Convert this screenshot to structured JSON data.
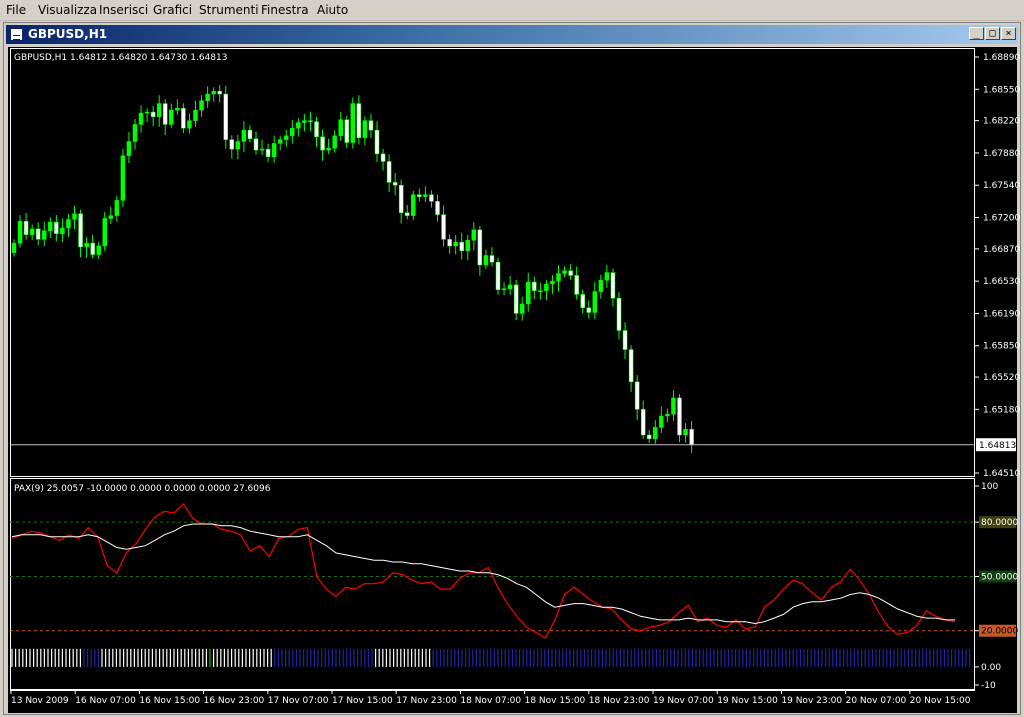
{
  "menu": [
    "File",
    "Visualizza",
    "Inserisci",
    "Grafici",
    "Strumenti",
    "Finestra",
    "Aiuto"
  ],
  "window": {
    "title": "GBPUSD,H1"
  },
  "colors": {
    "bull": "#ffffff",
    "bear": "#00ff00",
    "wick": "#00ff00",
    "pax": "#ff0000",
    "signal": "#ffffff",
    "grid_green": "#1e6e1e",
    "grid_orange": "#c85a28",
    "hist_white": "#ffffff",
    "hist_blue": "#2323a0"
  },
  "chart_data": [
    {
      "type": "candlestick",
      "header": "GBPUSD,H1  1.64812 1.64820 1.64730 1.64813",
      "ylim": [
        1.6451,
        1.6889
      ],
      "y_ticks": [
        "1.68890",
        "1.68550",
        "1.68220",
        "1.67880",
        "1.67540",
        "1.67200",
        "1.66870",
        "1.66530",
        "1.66190",
        "1.65850",
        "1.65520",
        "1.65180",
        "1.64510"
      ],
      "price_label": "1.64813",
      "last_price": 1.64813,
      "closes": [
        1.6693,
        1.6716,
        1.6702,
        1.6708,
        1.6697,
        1.6706,
        1.6715,
        1.6703,
        1.6709,
        1.6718,
        1.6724,
        1.6689,
        1.6693,
        1.6681,
        1.669,
        1.6719,
        1.6722,
        1.6738,
        1.6785,
        1.68,
        1.6818,
        1.683,
        1.6831,
        1.6826,
        1.684,
        1.6818,
        1.6833,
        1.6835,
        1.6814,
        1.6822,
        1.6833,
        1.6843,
        1.685,
        1.6853,
        1.685,
        1.6802,
        1.6792,
        1.68,
        1.6812,
        1.6803,
        1.6791,
        1.6792,
        1.6784,
        1.6798,
        1.6802,
        1.6806,
        1.6814,
        1.682,
        1.6822,
        1.6821,
        1.6805,
        1.6791,
        1.6793,
        1.6806,
        1.6823,
        1.6799,
        1.684,
        1.6804,
        1.6822,
        1.6812,
        1.6787,
        1.6779,
        1.6757,
        1.6754,
        1.6725,
        1.6722,
        1.6744,
        1.6742,
        1.6744,
        1.6737,
        1.6723,
        1.6697,
        1.669,
        1.6694,
        1.6685,
        1.6696,
        1.6707,
        1.667,
        1.668,
        1.6673,
        1.6644,
        1.6645,
        1.6649,
        1.6619,
        1.6629,
        1.6652,
        1.6643,
        1.6643,
        1.665,
        1.6653,
        1.6661,
        1.6664,
        1.6659,
        1.6639,
        1.6625,
        1.662,
        1.6642,
        1.6654,
        1.6662,
        1.6635,
        1.6601,
        1.6581,
        1.6547,
        1.6518,
        1.6491,
        1.6487,
        1.6499,
        1.6511,
        1.6513,
        1.653,
        1.6491,
        1.6497,
        1.6481
      ]
    },
    {
      "type": "line",
      "header": "PAX(9) 25.0057 -10.0000 0.0000 0.0000 0.0000 27.6096",
      "ylim": [
        -10,
        100
      ],
      "y_ticks": [
        "100",
        "80.0000",
        "50.0000",
        "20.0000",
        "0.00",
        "-10"
      ],
      "levels": [
        80,
        50,
        20
      ],
      "series": [
        {
          "values": [
            71,
            73,
            75,
            74,
            72,
            70,
            73,
            71,
            77,
            72,
            56,
            52,
            63,
            68,
            76,
            83,
            86,
            85,
            90,
            82,
            79,
            79,
            76,
            75,
            73,
            64,
            67,
            61,
            71,
            72,
            76,
            77,
            50,
            43,
            39,
            44,
            43,
            46,
            46,
            47,
            52,
            51,
            48,
            46,
            47,
            43,
            43,
            49,
            52,
            52,
            55,
            44,
            35,
            28,
            22,
            19,
            16,
            26,
            40,
            44,
            40,
            36,
            33,
            32,
            26,
            21,
            20,
            22,
            23,
            25,
            30,
            34,
            25,
            27,
            23,
            22,
            26,
            21,
            22,
            33,
            37,
            43,
            48,
            46,
            41,
            37,
            44,
            47,
            54,
            48,
            40,
            30,
            22,
            18,
            19,
            23,
            31,
            28,
            26,
            25
          ]
        },
        {
          "values": [
            72,
            73,
            73,
            73,
            72,
            72,
            72,
            72,
            73,
            72,
            69,
            66,
            65,
            66,
            67,
            70,
            73,
            75,
            78,
            79,
            79,
            79,
            78,
            78,
            77,
            75,
            74,
            73,
            72,
            72,
            72,
            73,
            70,
            67,
            63,
            62,
            61,
            60,
            59,
            59,
            58,
            58,
            57,
            57,
            56,
            55,
            54,
            53,
            53,
            52,
            52,
            51,
            49,
            46,
            44,
            40,
            36,
            33,
            34,
            35,
            35,
            34,
            33,
            33,
            32,
            30,
            28,
            27,
            26,
            26,
            26,
            27,
            26,
            26,
            26,
            25,
            25,
            25,
            24,
            25,
            27,
            29,
            33,
            35,
            36,
            36,
            37,
            38,
            40,
            41,
            40,
            38,
            35,
            32,
            30,
            28,
            27,
            27,
            26,
            26
          ]
        }
      ],
      "histogram": {
        "low": 0.0,
        "high": 10.0
      }
    }
  ],
  "x_labels": [
    "13 Nov 2009",
    "16 Nov 07:00",
    "16 Nov 15:00",
    "16 Nov 23:00",
    "17 Nov 07:00",
    "17 Nov 15:00",
    "17 Nov 23:00",
    "18 Nov 07:00",
    "18 Nov 15:00",
    "18 Nov 23:00",
    "19 Nov 07:00",
    "19 Nov 15:00",
    "19 Nov 23:00",
    "20 Nov 07:00",
    "20 Nov 15:00"
  ],
  "histogram_colors": "wwwwwwwwwwwwwwwwwwwwbbbbbwwwwwwwwwwwwwwwwwwwwwwwwwwwwwwgwwwwwwwwwwwwwwwwwbbbbbbbbbbbbbbbbbbbbbbbbbbbbwwwwwwwwwwwwwwwwbbbbbbbbbbbbbbbbbbbbbbbbbbbbbbbbbbbbbbbbbbbbbbbbbbbbbbbbbbbbbbbbbbbbbbbbbbbbbbbbbbbbbbbbbbbbbbbbbbbbbbbbbbbbbbbbbbbbbbbbbbbbbbbbbbbbbbbbbbbbbbbbbbbbbbbbbbbbbbbbbbbb"
}
